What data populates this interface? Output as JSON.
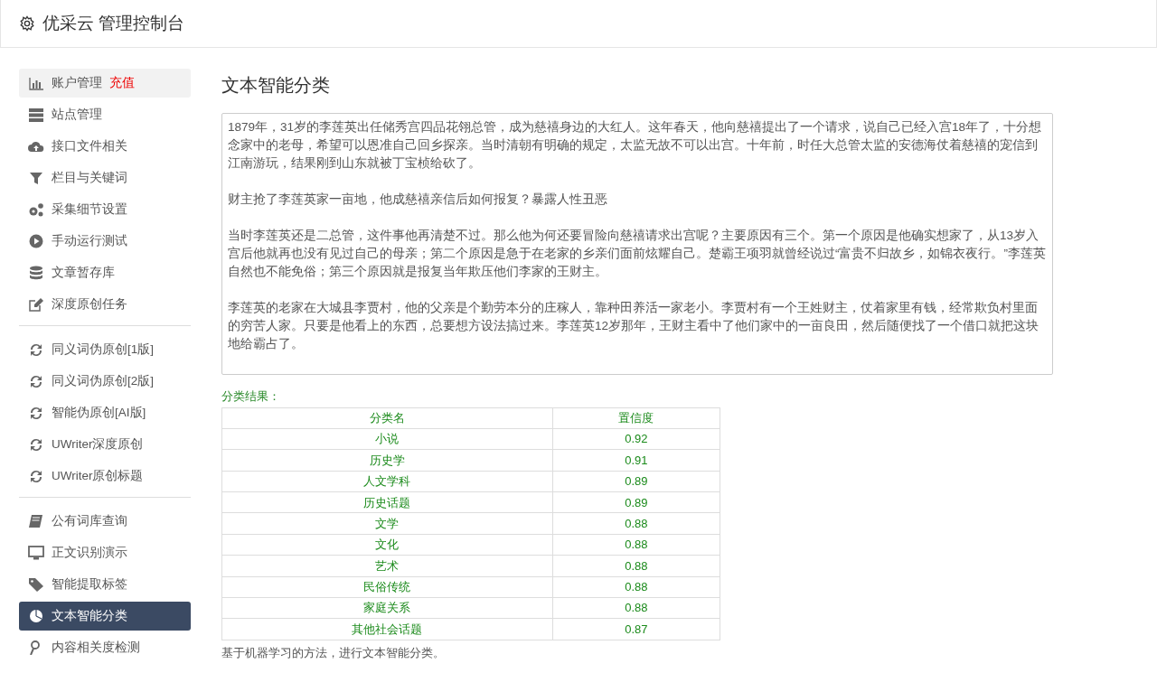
{
  "header": {
    "title": "优采云 管理控制台"
  },
  "sidebar": {
    "groups": [
      {
        "items": [
          {
            "label": "账户管理",
            "badge": "充值",
            "highlighted": true,
            "selected": false
          },
          {
            "label": "站点管理",
            "highlighted": false,
            "selected": false
          },
          {
            "label": "接口文件相关",
            "highlighted": false,
            "selected": false
          },
          {
            "label": "栏目与关键词",
            "highlighted": false,
            "selected": false
          },
          {
            "label": "采集细节设置",
            "highlighted": false,
            "selected": false
          },
          {
            "label": "手动运行测试",
            "highlighted": false,
            "selected": false
          },
          {
            "label": "文章暂存库",
            "highlighted": false,
            "selected": false
          },
          {
            "label": "深度原创任务",
            "highlighted": false,
            "selected": false
          }
        ]
      },
      {
        "items": [
          {
            "label": "同义词伪原创[1版]",
            "highlighted": false,
            "selected": false
          },
          {
            "label": "同义词伪原创[2版]",
            "highlighted": false,
            "selected": false
          },
          {
            "label": "智能伪原创[AI版]",
            "highlighted": false,
            "selected": false
          },
          {
            "label": "UWriter深度原创",
            "highlighted": false,
            "selected": false
          },
          {
            "label": "UWriter原创标题",
            "highlighted": false,
            "selected": false
          }
        ]
      },
      {
        "items": [
          {
            "label": "公有词库查询",
            "highlighted": false,
            "selected": false
          },
          {
            "label": "正文识别演示",
            "highlighted": false,
            "selected": false
          },
          {
            "label": "智能提取标签",
            "highlighted": false,
            "selected": false
          },
          {
            "label": "文本智能分类",
            "highlighted": false,
            "selected": true
          },
          {
            "label": "内容相关度检测",
            "highlighted": false,
            "selected": false
          }
        ]
      }
    ]
  },
  "main": {
    "title": "文本智能分类",
    "text_input": {
      "paragraphs": [
        "1879年，31岁的李莲英出任储秀宫四品花翎总管，成为慈禧身边的大红人。这年春天，他向慈禧提出了一个请求，说自己已经入宫18年了，十分想念家中的老母，希望可以恩准自己回乡探亲。当时清朝有明确的规定，太监无故不可以出宫。十年前，时任大总管太监的安德海仗着慈禧的宠信到江南游玩，结果刚到山东就被丁宝桢给砍了。",
        "财主抢了李莲英家一亩地，他成慈禧亲信后如何报复？暴露人性丑恶",
        "当时李莲英还是二总管，这件事他再清楚不过。那么他为何还要冒险向慈禧请求出宫呢？主要原因有三个。第一个原因是他确实想家了，从13岁入宫后他就再也没有见过自己的母亲；第二个原因是急于在老家的乡亲们面前炫耀自己。楚霸王项羽就曾经说过“富贵不归故乡，如锦衣夜行。”李莲英自然也不能免俗；第三个原因就是报复当年欺压他们李家的王财主。",
        "李莲英的老家在大城县李贾村，他的父亲是个勤劳本分的庄稼人，靠种田养活一家老小。李贾村有一个王姓财主，仗着家里有钱，经常欺负村里面的穷苦人家。只要是他看上的东西，总要想方设法搞过来。李莲英12岁那年，王财主看中了他们家中的一亩良田，然后随便找了一个借口就把这块地给霸占了。"
      ]
    },
    "result_label": "分类结果：",
    "table": {
      "columns": [
        "分类名",
        "置信度"
      ],
      "rows": [
        [
          "小说",
          "0.92"
        ],
        [
          "历史学",
          "0.91"
        ],
        [
          "人文学科",
          "0.89"
        ],
        [
          "历史话题",
          "0.89"
        ],
        [
          "文学",
          "0.88"
        ],
        [
          "文化",
          "0.88"
        ],
        [
          "艺术",
          "0.88"
        ],
        [
          "民俗传统",
          "0.88"
        ],
        [
          "家庭关系",
          "0.88"
        ],
        [
          "其他社会话题",
          "0.87"
        ]
      ]
    },
    "footnote": "基于机器学习的方法，进行文本智能分类。"
  }
}
